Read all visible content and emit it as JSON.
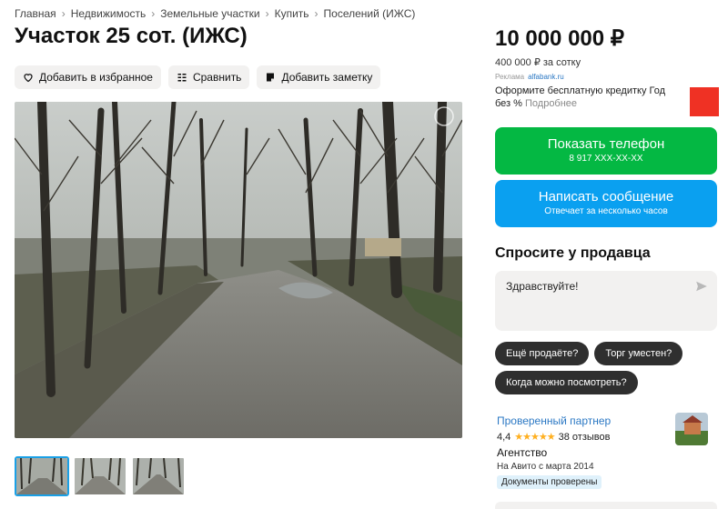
{
  "breadcrumb": [
    "Главная",
    "Недвижимость",
    "Земельные участки",
    "Купить",
    "Поселений (ИЖС)"
  ],
  "title": "Участок 25 сот. (ИЖС)",
  "actions": {
    "favorite": "Добавить в избранное",
    "compare": "Сравнить",
    "note": "Добавить заметку"
  },
  "price": {
    "total": "10 000 000 ₽",
    "per_unit": "400 000 ₽ за сотку"
  },
  "ad": {
    "label": "Реклама",
    "sponsor": "alfabank.ru",
    "text": "Оформите бесплатную кредитку Год без %",
    "more": "Подробнее",
    "logo_color": "#ef3124"
  },
  "phone_button": {
    "label": "Показать телефон",
    "number": "8 917 XXX-XX-XX",
    "color": "#04b843"
  },
  "message_button": {
    "label": "Написать сообщение",
    "sub": "Отвечает за несколько часов",
    "color": "#0aa0f0"
  },
  "ask": {
    "title": "Спросите у продавца",
    "message": "Здравствуйте!",
    "chips": [
      "Ещё продаёте?",
      "Торг уместен?",
      "Когда можно посмотреть?"
    ]
  },
  "seller": {
    "partner": "Проверенный партнер",
    "rating": "4,4",
    "stars": "★★★★★",
    "reviews": "38 отзывов",
    "type": "Агентство",
    "since": "На Авито с марта 2014",
    "docs": "Документы проверены"
  },
  "gallery": {
    "count": 3,
    "active_index": 0,
    "active_color": "#1aa0e6"
  }
}
